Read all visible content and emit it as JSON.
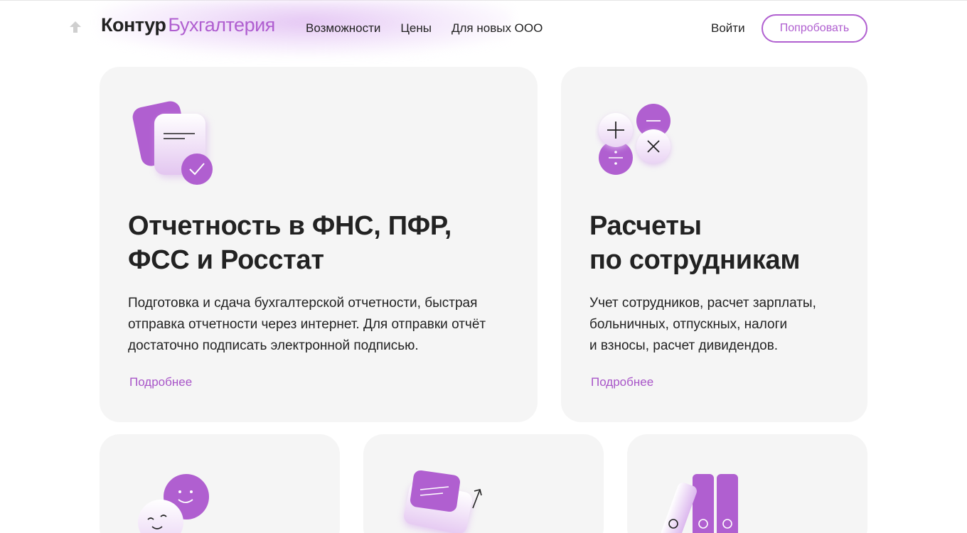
{
  "header": {
    "logo_brand": "Контур",
    "logo_product": "Бухгалтерия",
    "nav": [
      {
        "label": "Возможности"
      },
      {
        "label": "Цены"
      },
      {
        "label": "Для новых ООО"
      }
    ],
    "login": "Войти",
    "try_button": "Попробовать"
  },
  "cards": [
    {
      "title_lines": [
        "Отчетность в ФНС, ПФР,",
        "ФСС и Росстат"
      ],
      "description_lines": [
        "Подготовка и сдача бухгалтерской отчетности, быстрая",
        "отправка отчетности через интернет. Для отправки отчёт",
        "достаточно подписать электронной подписью."
      ],
      "link": "Подробнее",
      "icon": "document-check-icon"
    },
    {
      "title_lines": [
        "Расчеты",
        "по сотрудникам"
      ],
      "description_lines": [
        "Учет сотрудников, расчет зарплаты,",
        "больничных, отпускных, налоги",
        "и взносы, расчет дивидендов."
      ],
      "link": "Подробнее",
      "icon": "math-operations-icon"
    },
    {
      "icon": "smiley-faces-icon"
    },
    {
      "icon": "envelope-arrow-icon"
    },
    {
      "icon": "binders-icon"
    }
  ],
  "colors": {
    "accent": "#b05fd0",
    "card_bg": "#f5f5f5",
    "text": "#222222"
  }
}
